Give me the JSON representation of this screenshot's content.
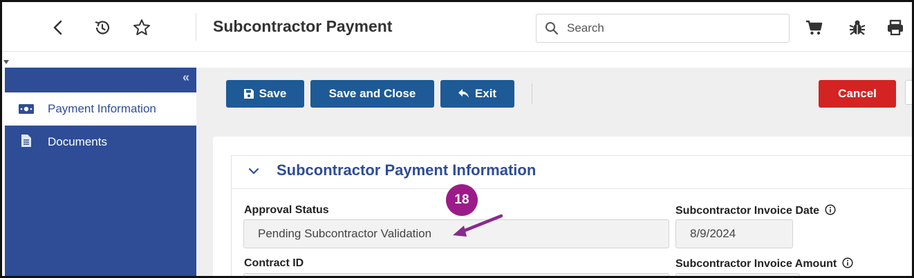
{
  "header": {
    "title": "Subcontractor Payment",
    "search_placeholder": "Search",
    "icons": [
      "back-arrow-icon",
      "history-icon",
      "star-icon",
      "cart-icon",
      "bug-icon",
      "print-icon"
    ]
  },
  "sidebar": {
    "collapse_icon": "double-chevron-left-icon",
    "items": [
      {
        "label": "Payment Information",
        "icon": "money-icon",
        "active": true
      },
      {
        "label": "Documents",
        "icon": "document-icon",
        "active": false
      }
    ]
  },
  "toolbar": {
    "save_label": "Save",
    "save_close_label": "Save and Close",
    "exit_label": "Exit",
    "cancel_label": "Cancel"
  },
  "section": {
    "title": "Subcontractor Payment Information",
    "fields": {
      "approval_status_label": "Approval Status",
      "approval_status_value": "Pending Subcontractor Validation",
      "invoice_date_label": "Subcontractor Invoice Date",
      "invoice_date_value": "8/9/2024",
      "contract_id_label": "Contract ID",
      "invoice_amount_label": "Subcontractor Invoice Amount"
    }
  },
  "annotation": {
    "step_number": "18"
  },
  "colors": {
    "primary": "#1d5a96",
    "sidebar": "#2e4d96",
    "cancel": "#d32323",
    "annotation": "#9b1b8a"
  }
}
